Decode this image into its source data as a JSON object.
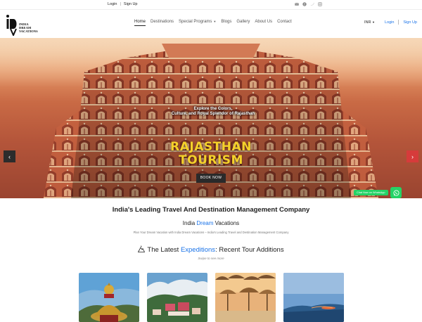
{
  "topbar": {
    "login": "Login",
    "signup": "Sign Up",
    "social": [
      "mail-icon",
      "facebook-icon",
      "twitter-icon",
      "instagram-icon"
    ]
  },
  "header": {
    "logo_text": [
      "INDIA",
      "DREAM",
      "VACATIONS"
    ],
    "nav": [
      {
        "label": "Home",
        "active": true
      },
      {
        "label": "Destinations"
      },
      {
        "label": "Special Programs",
        "has_dropdown": true
      },
      {
        "label": "Blogs"
      },
      {
        "label": "Gallery"
      },
      {
        "label": "About Us"
      },
      {
        "label": "Contact"
      }
    ],
    "currency": "INR",
    "login": "Login",
    "signup": "Sign Up"
  },
  "hero": {
    "tagline_1": "Explore the Colors,",
    "tagline_2": "Culture, and Royal Splendor of Rajasthan",
    "title": "RAJASTHAN TOURISM",
    "book_label": "BOOK NOW",
    "prev": "‹",
    "next": "›",
    "whatsapp_label": "Chat Now on WhatsApp",
    "colors": {
      "title": "#f5d12a",
      "next_arrow": "#d63b3b",
      "whatsapp": "#25d366"
    }
  },
  "intro": {
    "heading": "India's Leading Travel And Destination Management Company",
    "brand_1": "India",
    "brand_2": "Dream",
    "brand_3": "Vacations",
    "crumb": "Plan Your Dream Vacation with India Dream Vacations – India's Leading Travel and Destination Management Company"
  },
  "latest": {
    "prefix": "The Latest",
    "highlight": "Expeditions",
    "suffix": ": Recent Tour Additions",
    "swipe": "Swipe to see more"
  },
  "cards": [
    "card-buddha",
    "card-hill-town",
    "card-beach-umbrellas",
    "card-coastline"
  ]
}
